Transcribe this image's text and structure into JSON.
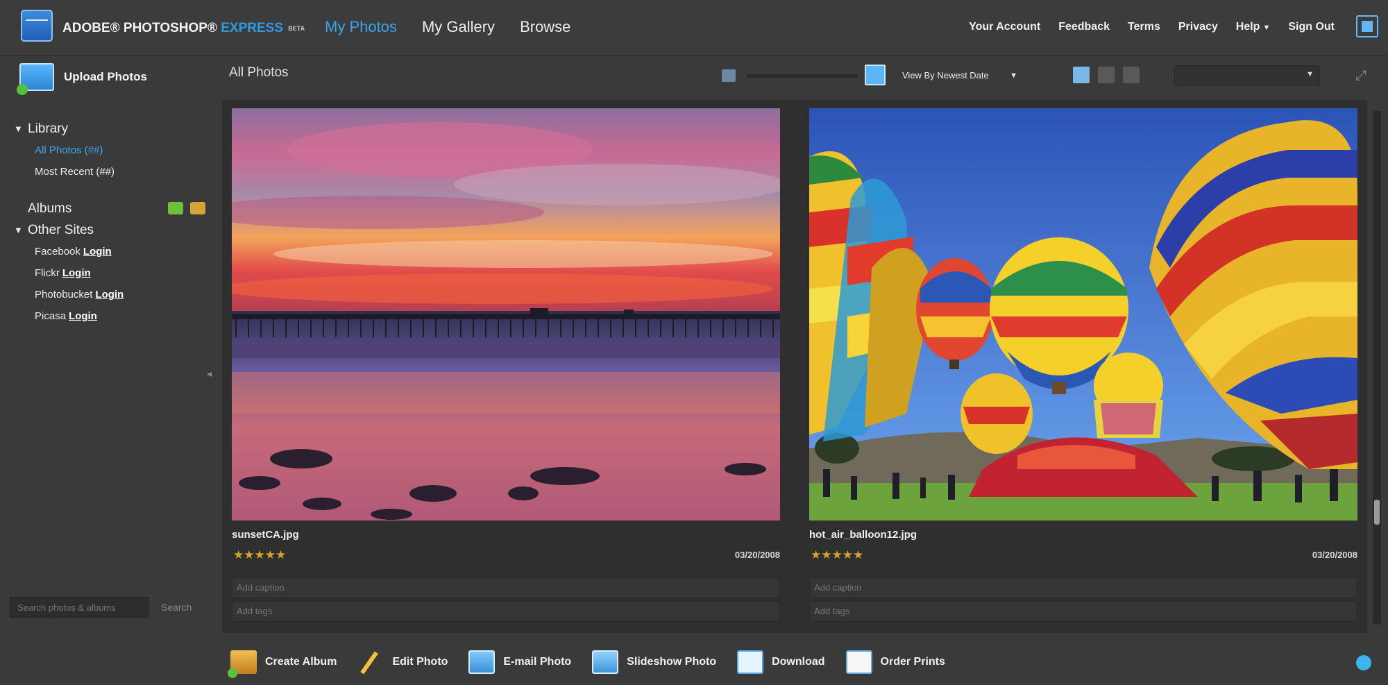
{
  "header": {
    "brand_part1": "ADOBE® PHOTOSHOP®",
    "brand_part2": "EXPRESS",
    "brand_beta": "BETA",
    "nav": [
      "My Photos",
      "My Gallery",
      "Browse"
    ],
    "links": [
      "Your Account",
      "Feedback",
      "Terms",
      "Privacy",
      "Help",
      "Sign Out"
    ]
  },
  "sidebar": {
    "upload_label": "Upload Photos",
    "library_label": "Library",
    "library_items": [
      "All Photos (##)",
      "Most Recent (##)"
    ],
    "albums_label": "Albums",
    "other_sites_label": "Other Sites",
    "sites": [
      {
        "name": "Facebook",
        "login": "Login"
      },
      {
        "name": "Flickr",
        "login": "Login"
      },
      {
        "name": "Photobucket",
        "login": "Login"
      },
      {
        "name": "Picasa",
        "login": "Login"
      }
    ],
    "search_placeholder": "Search photos & albums",
    "search_button": "Search"
  },
  "toolbar": {
    "title": "All Photos",
    "sort_label": "View By Newest Date",
    "filter_value": ""
  },
  "photos": [
    {
      "filename": "sunsetCA.jpg",
      "rating": 0,
      "stars": "★★★★★",
      "date": "03/20/2008",
      "caption_placeholder": "Add caption",
      "tags_placeholder": "Add tags"
    },
    {
      "filename": "hot_air_balloon12.jpg",
      "rating": 0,
      "stars": "★★★★★",
      "date": "03/20/2008",
      "caption_placeholder": "Add caption",
      "tags_placeholder": "Add tags"
    }
  ],
  "actions": [
    "Create Album",
    "Edit Photo",
    "E-mail Photo",
    "Slideshow Photo",
    "Download",
    "Order Prints"
  ],
  "colors": {
    "accent": "#37a4f0",
    "background": "#3a3a3a",
    "star": "#d4a528"
  },
  "icons": {
    "logo": "adobe-photoshop-express-logo",
    "upload": "upload-photos-icon",
    "help": "help-circle-icon"
  }
}
